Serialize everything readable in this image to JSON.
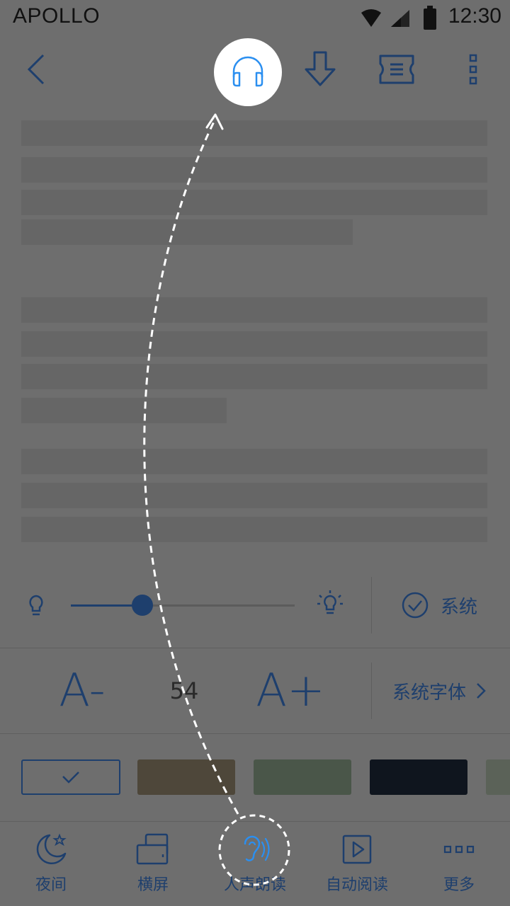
{
  "status_bar": {
    "carrier": "APOLLO",
    "time": "12:30"
  },
  "toolbar": {
    "items": [
      {
        "name": "back",
        "icon": "chevron-left-icon"
      },
      {
        "name": "listen",
        "icon": "headphones-icon"
      },
      {
        "name": "download",
        "icon": "download-icon"
      },
      {
        "name": "ticket",
        "icon": "ticket-icon"
      },
      {
        "name": "more",
        "icon": "more-vertical-icon"
      }
    ]
  },
  "settings": {
    "brightness": {
      "value": 0.32,
      "follow_system_label": "系统",
      "follow_system_checked": true
    },
    "font": {
      "decrease_label": "A-",
      "increase_label": "A+",
      "size": "54",
      "font_face_label": "系统字体"
    },
    "themes": [
      {
        "color": "#1f3a63",
        "selected": true
      },
      {
        "color": "#4e473a",
        "selected": false
      },
      {
        "color": "#4a5649",
        "selected": false
      },
      {
        "color": "#0f151e",
        "selected": false
      },
      {
        "color": "#5b6258",
        "selected": false
      }
    ]
  },
  "bottom_tabs": [
    {
      "label": "夜间",
      "icon": "moon-icon"
    },
    {
      "label": "横屏",
      "icon": "landscape-icon"
    },
    {
      "label": "人声朗读",
      "icon": "ear-icon"
    },
    {
      "label": "自动阅读",
      "icon": "play-icon"
    },
    {
      "label": "更多",
      "icon": "more-horizontal-icon"
    }
  ],
  "colors": {
    "accent": "#2b8ff0",
    "dim_blue": "#1e3f6d",
    "overlay": "#6e6e6e",
    "highlight": "#ffffff"
  }
}
